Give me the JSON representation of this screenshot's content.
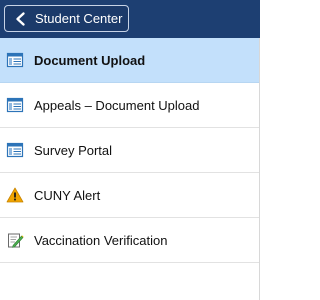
{
  "header": {
    "back_label": "Student Center"
  },
  "nav": {
    "items": [
      {
        "label": "Document Upload",
        "icon": "document-window-icon",
        "active": true
      },
      {
        "label": "Appeals – Document Upload",
        "icon": "document-window-icon",
        "active": false
      },
      {
        "label": "Survey Portal",
        "icon": "document-window-icon",
        "active": false
      },
      {
        "label": "CUNY Alert",
        "icon": "warning-icon",
        "active": false
      },
      {
        "label": "Vaccination Verification",
        "icon": "edit-document-icon",
        "active": false
      }
    ]
  },
  "colors": {
    "header_bg": "#1d3f72",
    "active_bg": "#c3e0fb",
    "warning": "#f0a400"
  }
}
